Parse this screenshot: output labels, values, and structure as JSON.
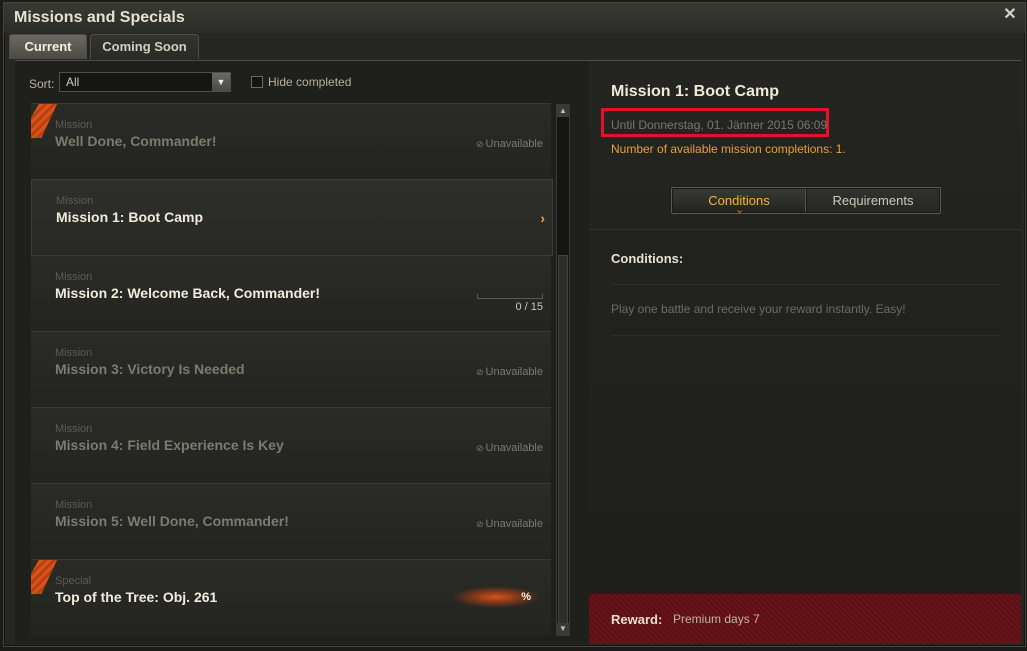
{
  "window": {
    "title": "Missions and Specials",
    "close_glyph": "✕"
  },
  "tabs": [
    {
      "label": "Current",
      "active": true
    },
    {
      "label": "Coming Soon",
      "active": false
    }
  ],
  "filter": {
    "sort_label": "Sort:",
    "sort_value": "All",
    "hide_completed_label": "Hide completed",
    "hide_completed_checked": false
  },
  "missions": [
    {
      "kind": "Mission",
      "name": "Well Done, Commander!",
      "status": "Unavailable",
      "ribbon": true,
      "dim": true
    },
    {
      "kind": "Mission",
      "name": "Mission 1: Boot Camp",
      "status": "",
      "selected": true,
      "dim": false
    },
    {
      "kind": "Mission",
      "name": "Mission 2: Welcome Back, Commander!",
      "progress_text": "0 / 15",
      "progress_fraction": 0.0,
      "dim": false
    },
    {
      "kind": "Mission",
      "name": "Mission 3: Victory Is Needed",
      "status": "Unavailable",
      "dim": true
    },
    {
      "kind": "Mission",
      "name": "Mission 4: Field Experience Is Key",
      "status": "Unavailable",
      "dim": true
    },
    {
      "kind": "Mission",
      "name": "Mission 5: Well Done, Commander!",
      "status": "Unavailable",
      "dim": true
    },
    {
      "kind": "Special",
      "name": "Top of the Tree: Obj. 261",
      "badge": "%",
      "ribbon": true,
      "dim": false
    }
  ],
  "detail": {
    "title": "Mission 1: Boot Camp",
    "until": "Until Donnerstag, 01. Jänner 2015 06:09",
    "completions": "Number of available mission completions: 1.",
    "tabs": {
      "conditions": "Conditions",
      "requirements": "Requirements"
    },
    "conditions_heading": "Conditions:",
    "conditions_text": "Play one battle and receive your reward instantly. Easy!",
    "reward_label": "Reward:",
    "reward_value": "Premium days 7"
  },
  "colors": {
    "accent": "#f3b640",
    "highlight_box": "#e3122a",
    "ribbon": "#d9541b"
  }
}
